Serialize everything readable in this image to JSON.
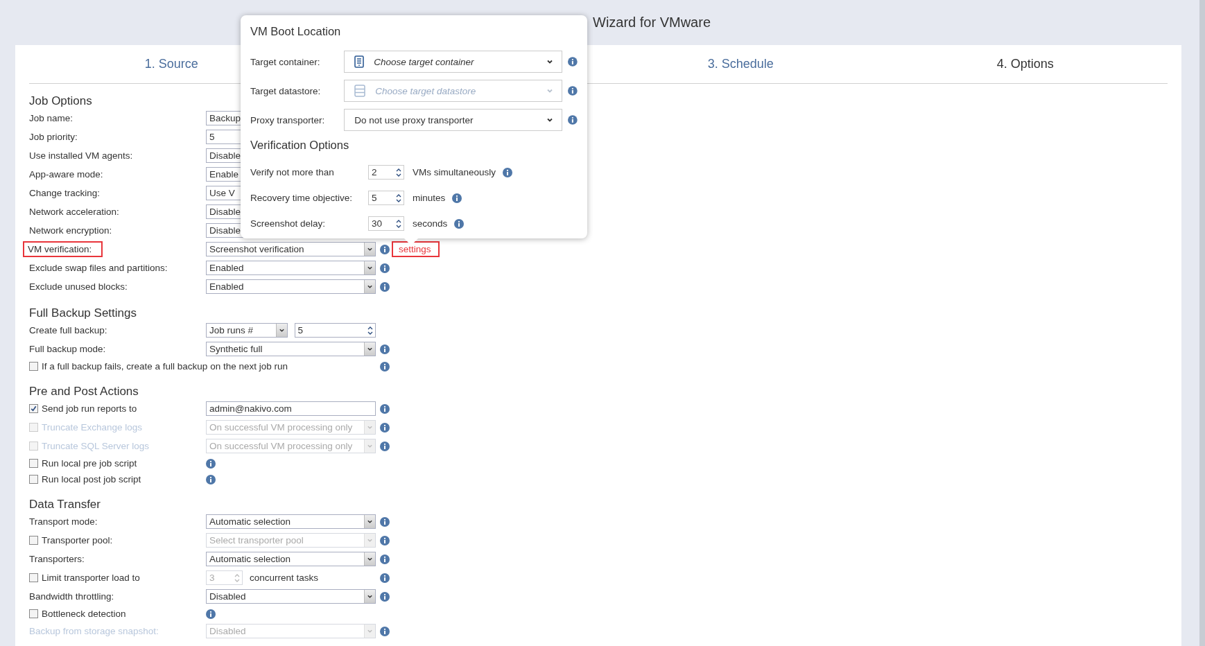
{
  "window": {
    "title": "Wizard for VMware"
  },
  "tabs": [
    {
      "label": "1. Source",
      "selected": false
    },
    {
      "label": "3. Schedule",
      "selected": false
    },
    {
      "label": "4. Options",
      "selected": true
    }
  ],
  "sections": [
    {
      "title": "Job Options",
      "rows": [
        {
          "kind": "field",
          "label": "Job name:",
          "controls": [
            {
              "kind": "text",
              "value": "Backup"
            }
          ]
        },
        {
          "kind": "field",
          "label": "Job priority:",
          "controls": [
            {
              "kind": "text",
              "value": "5"
            }
          ]
        },
        {
          "kind": "field",
          "label": "Use installed VM agents:",
          "controls": [
            {
              "kind": "select",
              "value": "Disable"
            }
          ]
        },
        {
          "kind": "field",
          "label": "App-aware mode:",
          "controls": [
            {
              "kind": "select",
              "value": "Enable"
            }
          ]
        },
        {
          "kind": "field",
          "label": "Change tracking:",
          "controls": [
            {
              "kind": "select",
              "value": "Use V"
            }
          ]
        },
        {
          "kind": "field",
          "label": "Network acceleration:",
          "controls": [
            {
              "kind": "select",
              "value": "Disable"
            }
          ]
        },
        {
          "kind": "field",
          "label": "Network encryption:",
          "controls": [
            {
              "kind": "select",
              "value": "Disable"
            }
          ]
        },
        {
          "kind": "field",
          "label": "VM verification:",
          "highlighted": true,
          "controls": [
            {
              "kind": "select",
              "value": "Screenshot verification"
            }
          ],
          "info": true,
          "link": {
            "text": "settings",
            "highlighted": true
          }
        },
        {
          "kind": "field",
          "label": "Exclude swap files and partitions:",
          "controls": [
            {
              "kind": "select",
              "value": "Enabled"
            }
          ],
          "info": true
        },
        {
          "kind": "field",
          "label": "Exclude unused blocks:",
          "controls": [
            {
              "kind": "select",
              "value": "Enabled"
            }
          ],
          "info": true
        }
      ]
    },
    {
      "title": "Full Backup Settings",
      "rows": [
        {
          "kind": "field",
          "label": "Create full backup:",
          "controls": [
            {
              "kind": "select",
              "value": "Job runs #"
            },
            {
              "kind": "spin",
              "value": "5"
            }
          ]
        },
        {
          "kind": "field",
          "label": "Full backup mode:",
          "controls": [
            {
              "kind": "select",
              "value": "Synthetic full"
            }
          ],
          "info": true
        },
        {
          "kind": "check_wide",
          "label": "If a full backup fails, create a full backup on the next job run",
          "checked": false,
          "info": true
        }
      ]
    },
    {
      "title": "Pre and Post Actions",
      "rows": [
        {
          "kind": "check_field",
          "label": "Send job run reports to",
          "checked": true,
          "controls": [
            {
              "kind": "text",
              "value": "admin@nakivo.com"
            }
          ],
          "info": true
        },
        {
          "kind": "check_field",
          "label": "Truncate Exchange logs",
          "checked": false,
          "disabled": true,
          "controls": [
            {
              "kind": "select",
              "value": "On successful VM processing only",
              "disabled": true
            }
          ],
          "info": true
        },
        {
          "kind": "check_field",
          "label": "Truncate SQL Server logs",
          "checked": false,
          "disabled": true,
          "controls": [
            {
              "kind": "select",
              "value": "On successful VM processing only",
              "disabled": true
            }
          ],
          "info": true
        },
        {
          "kind": "check",
          "label": "Run local pre job script",
          "checked": false,
          "info": true
        },
        {
          "kind": "check",
          "label": "Run local post job script",
          "checked": false,
          "info": true
        }
      ]
    },
    {
      "title": "Data Transfer",
      "rows": [
        {
          "kind": "field",
          "label": "Transport mode:",
          "controls": [
            {
              "kind": "select",
              "value": "Automatic selection"
            }
          ],
          "info": true
        },
        {
          "kind": "check_field",
          "label": "Transporter pool:",
          "checked": false,
          "controls": [
            {
              "kind": "select",
              "placeholder": "Select transporter pool",
              "disabled": true
            }
          ],
          "info": true
        },
        {
          "kind": "field",
          "label": "Transporters:",
          "controls": [
            {
              "kind": "select",
              "value": "Automatic selection"
            }
          ],
          "info": true
        },
        {
          "kind": "check_field",
          "label": "Limit transporter load to",
          "checked": false,
          "controls": [
            {
              "kind": "spin",
              "value": "3",
              "disabled": true
            }
          ],
          "suffix": "concurrent tasks",
          "info": true
        },
        {
          "kind": "field",
          "label": "Bandwidth throttling:",
          "controls": [
            {
              "kind": "select",
              "value": "Disabled"
            }
          ],
          "info": true
        },
        {
          "kind": "check",
          "label": "Bottleneck detection",
          "checked": false,
          "info": true
        },
        {
          "kind": "field",
          "label": "Backup from storage snapshot:",
          "disabled": true,
          "controls": [
            {
              "kind": "select",
              "value": "Disabled",
              "disabled": true
            }
          ],
          "info": true
        }
      ]
    }
  ],
  "popup": {
    "title": "VM Boot Location",
    "rows": [
      {
        "label": "Target container:",
        "placeholder": "Choose target container",
        "disabled": false,
        "info": true
      },
      {
        "label": "Target datastore:",
        "placeholder": "Choose target datastore",
        "disabled": true,
        "info": true
      },
      {
        "label": "Proxy transporter:",
        "value": "Do not use proxy transporter",
        "disabled": false,
        "info": true
      }
    ],
    "verification_title": "Verification Options",
    "verification_rows": [
      {
        "label": "Verify not more than",
        "value": "2",
        "suffix": "VMs simultaneously",
        "info": true
      },
      {
        "label": "Recovery time objective:",
        "value": "5",
        "suffix": "minutes",
        "info": true
      },
      {
        "label": "Screenshot delay:",
        "value": "30",
        "suffix": "seconds",
        "info": true
      }
    ]
  }
}
